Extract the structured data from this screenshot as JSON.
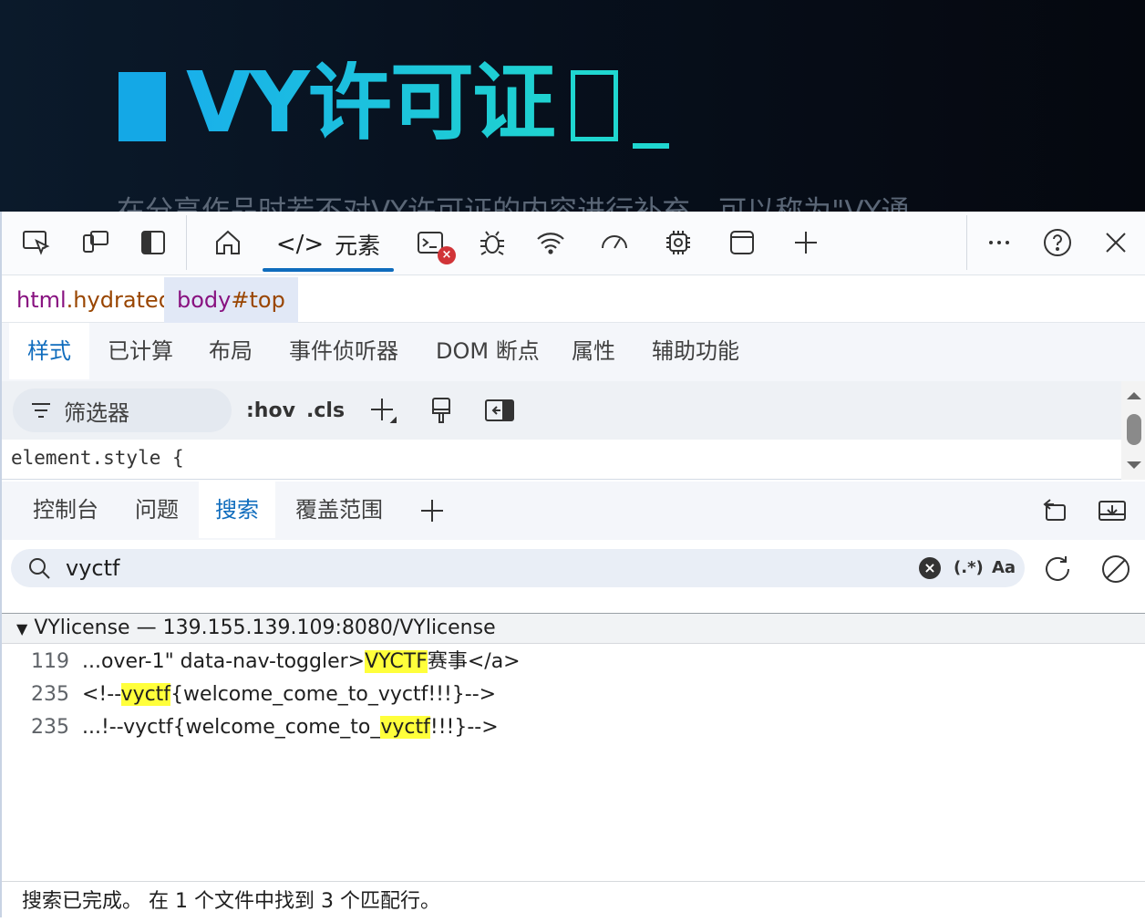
{
  "page": {
    "hero_title": "VY许可证",
    "subtitle": "在分享作品时若不对VY许可证的内容进行补充，可以称为\"VY通"
  },
  "devtools": {
    "toolbar": {
      "elements_tab_label": "元素",
      "error_badge": "×"
    },
    "breadcrumbs": [
      {
        "tag": "html",
        "attr": ".hydrated"
      },
      {
        "tag": "body",
        "attr": "#top"
      }
    ],
    "style_tabs": [
      "样式",
      "已计算",
      "布局",
      "事件侦听器",
      "DOM 断点",
      "属性",
      "辅助功能"
    ],
    "filter": {
      "placeholder": "筛选器",
      "hov": ":hov",
      "cls": ".cls"
    },
    "element_style": "element.style {",
    "drawer_tabs": [
      "控制台",
      "问题",
      "搜索",
      "覆盖范围"
    ],
    "search": {
      "query": "vyctf",
      "regex_label": "(.*)",
      "case_label": "Aa"
    },
    "results": {
      "file": "VYlicense — 139.155.139.109:8080/VYlicense",
      "rows": [
        {
          "line": "119",
          "before": "...over-1\" data-nav-toggler>",
          "match": "VYCTF",
          "after": "赛事</a>"
        },
        {
          "line": "235",
          "before": "<!--",
          "match": "vyctf",
          "after": "{welcome_come_to_vyctf!!!}-->"
        },
        {
          "line": "235",
          "before": "...!--vyctf{welcome_come_to_",
          "match": "vyctf",
          "after": "!!!}-->"
        }
      ]
    },
    "status": "搜索已完成。  在 1 个文件中找到 3 个匹配行。",
    "colors": {
      "accent": "#0f6cbd",
      "highlight": "#ffff3b",
      "hero": "#1fd3d0"
    }
  }
}
